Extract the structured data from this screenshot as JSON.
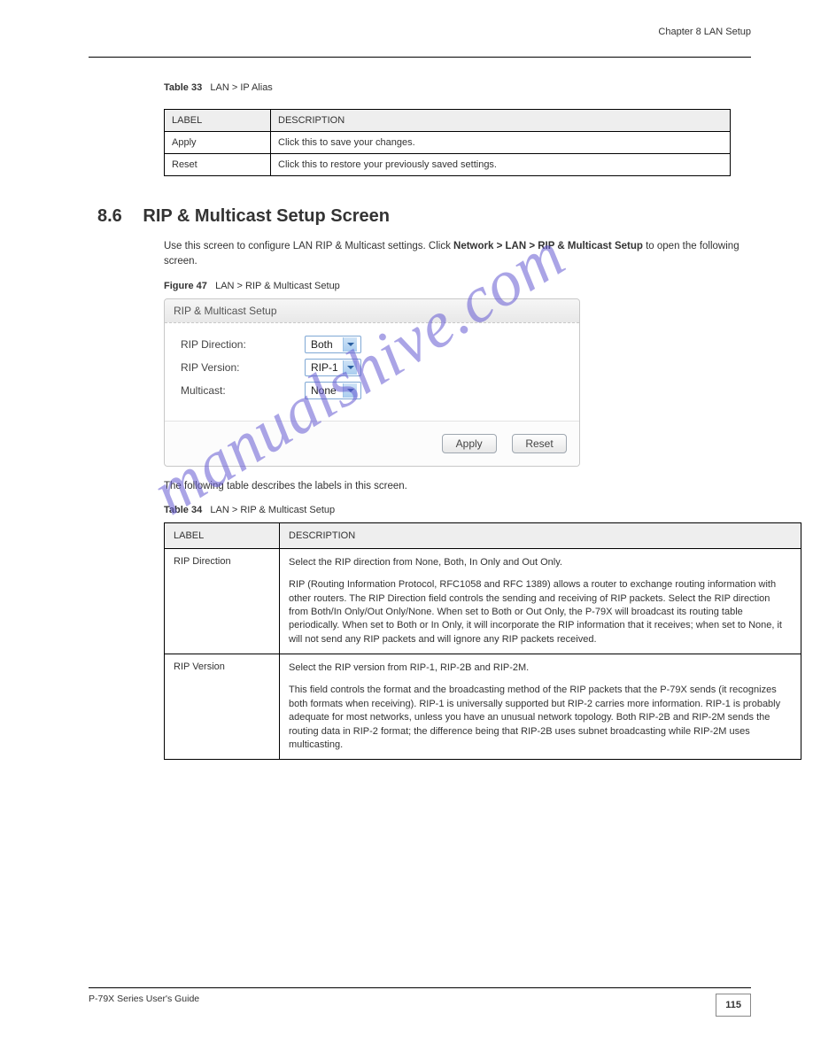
{
  "header": {
    "chapter_label": "Chapter 8 LAN Setup"
  },
  "table1": {
    "caption_prefix": "Table 33",
    "caption_text": "LAN > IP Alias",
    "headers": {
      "label": "LABEL",
      "description": "DESCRIPTION"
    },
    "rows": [
      {
        "label": "Apply",
        "description": "Click this to save your changes."
      },
      {
        "label": "Reset",
        "description": "Click this to restore your previously saved settings."
      }
    ]
  },
  "section": {
    "number": "8.6",
    "title": "RIP & Multicast Setup Screen",
    "para1_a": "Use this screen to configure LAN RIP & Multicast settings. Click ",
    "para1_b": "Network > LAN > RIP & Multicast Setup",
    "para1_c": " to open the following screen."
  },
  "figure": {
    "caption_prefix": "Figure 47",
    "caption_text": "LAN > RIP & Multicast Setup"
  },
  "ui_panel": {
    "title": "RIP & Multicast Setup",
    "rows": [
      {
        "label": "RIP Direction:",
        "value": "Both"
      },
      {
        "label": "RIP Version:",
        "value": "RIP-1"
      },
      {
        "label": "Multicast:",
        "value": "None"
      }
    ],
    "apply": "Apply",
    "reset": "Reset"
  },
  "table2_intro": "The following table describes the labels in this screen.",
  "table2": {
    "caption_prefix": "Table 34",
    "caption_text": "LAN > RIP & Multicast Setup",
    "headers": {
      "label": "LABEL",
      "description": "DESCRIPTION"
    },
    "rows": [
      {
        "label": "RIP Direction",
        "p1": "Select the RIP direction from None, Both, In Only and Out Only.",
        "p2": "RIP (Routing Information Protocol, RFC1058 and RFC 1389) allows a router to exchange routing information with other routers. The RIP Direction field controls the sending and receiving of RIP packets. Select the RIP direction from Both/In Only/Out Only/None. When set to Both or Out Only, the P-79X will broadcast its routing table periodically. When set to Both or In Only, it will incorporate the RIP information that it receives; when set to None, it will not send any RIP packets and will ignore any RIP packets received."
      },
      {
        "label": "RIP Version",
        "p1": "Select the RIP version from RIP-1, RIP-2B and RIP-2M.",
        "p2": "This field controls the format and the broadcasting method of the RIP packets that the P-79X sends (it recognizes both formats when receiving). RIP-1 is universally supported but RIP-2 carries more information. RIP-1 is probably adequate for most networks, unless you have an unusual network topology. Both RIP-2B and RIP-2M sends the routing data in RIP-2 format; the difference being that RIP-2B uses subnet broadcasting while RIP-2M uses multicasting."
      }
    ]
  },
  "footer": {
    "left": "P-79X Series User's Guide",
    "page": "115"
  },
  "watermark": "manualshive.com"
}
